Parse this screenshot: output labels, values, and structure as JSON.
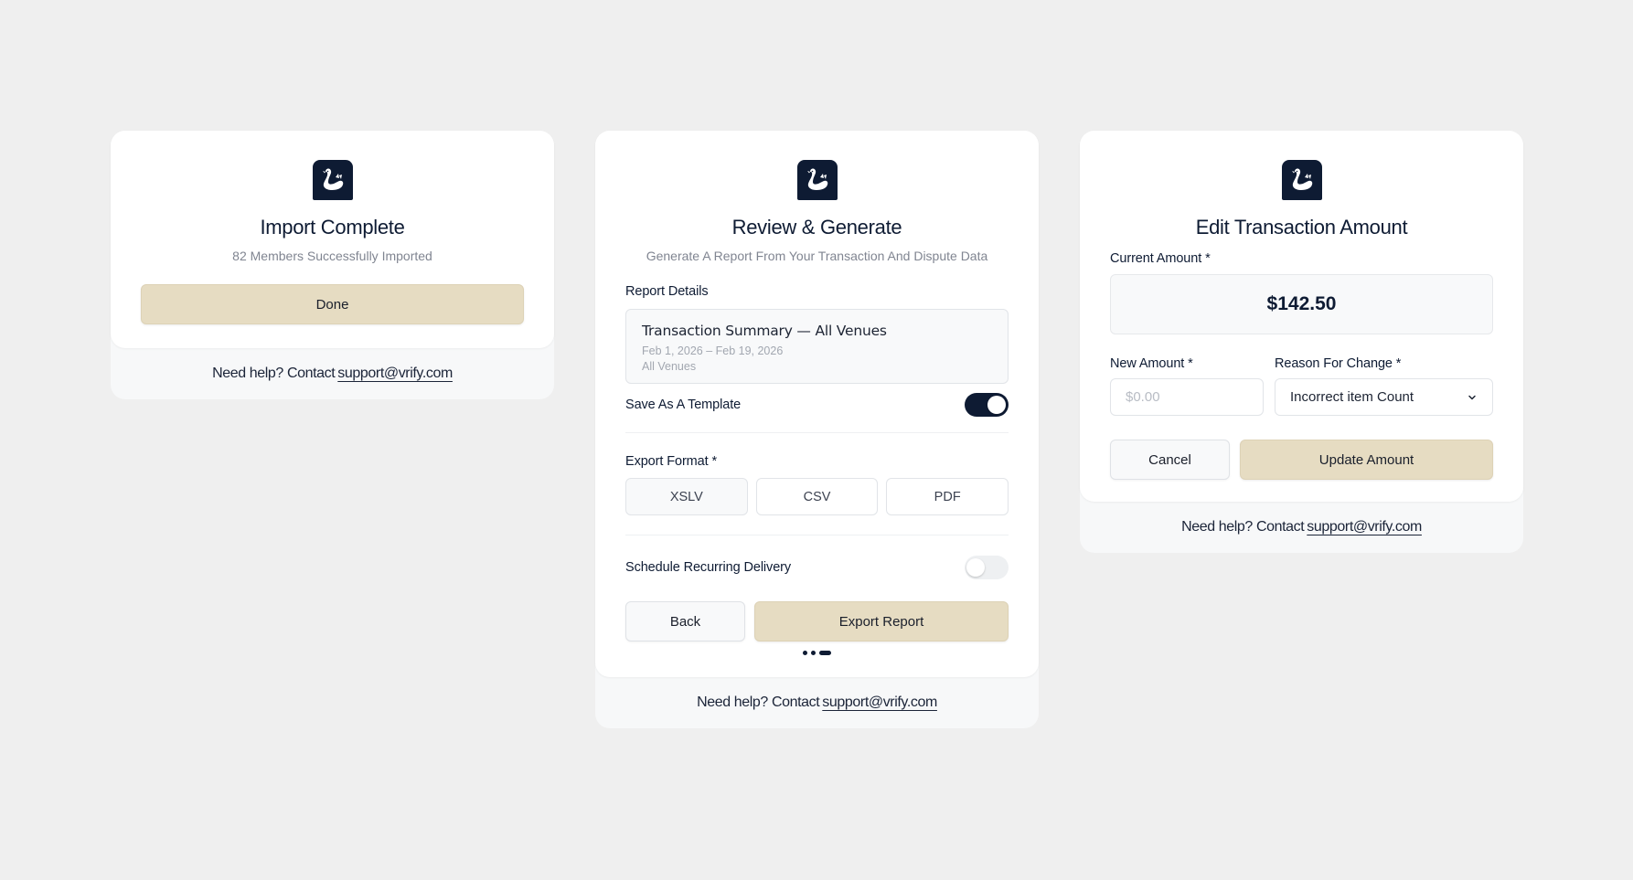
{
  "brand": {
    "logo_icon": "swan-icon",
    "color": "#0e1b33",
    "accent": "#e6dcc2"
  },
  "footer": {
    "help_text": "Need help? Contact",
    "email": "support@vrify.com"
  },
  "import_card": {
    "title": "Import Complete",
    "subtitle": "82 Members Successfully Imported",
    "done_label": "Done"
  },
  "review_card": {
    "title": "Review & Generate",
    "subtitle": "Generate A Report From Your Transaction And Dispute Data",
    "report_details_label": "Report Details",
    "report": {
      "name": "Transaction Summary — All Venues",
      "date_range": "Feb 1, 2026 – Feb 19, 2026",
      "venues": "All Venues"
    },
    "save_template_label": "Save As A Template",
    "save_template_on": true,
    "export_format_label": "Export Format *",
    "formats": [
      "XSLV",
      "CSV",
      "PDF"
    ],
    "selected_format": "XSLV",
    "schedule_label": "Schedule Recurring Delivery",
    "schedule_on": false,
    "back_label": "Back",
    "export_label": "Export Report",
    "step": {
      "current": 3,
      "total": 3
    }
  },
  "edit_card": {
    "title": "Edit Transaction Amount",
    "current_amount_label": "Current Amount *",
    "current_amount": "$142.50",
    "new_amount_label": "New Amount *",
    "new_amount_placeholder": "$0.00",
    "reason_label": "Reason For Change *",
    "reason_value": "Incorrect item Count",
    "cancel_label": "Cancel",
    "update_label": "Update Amount"
  }
}
